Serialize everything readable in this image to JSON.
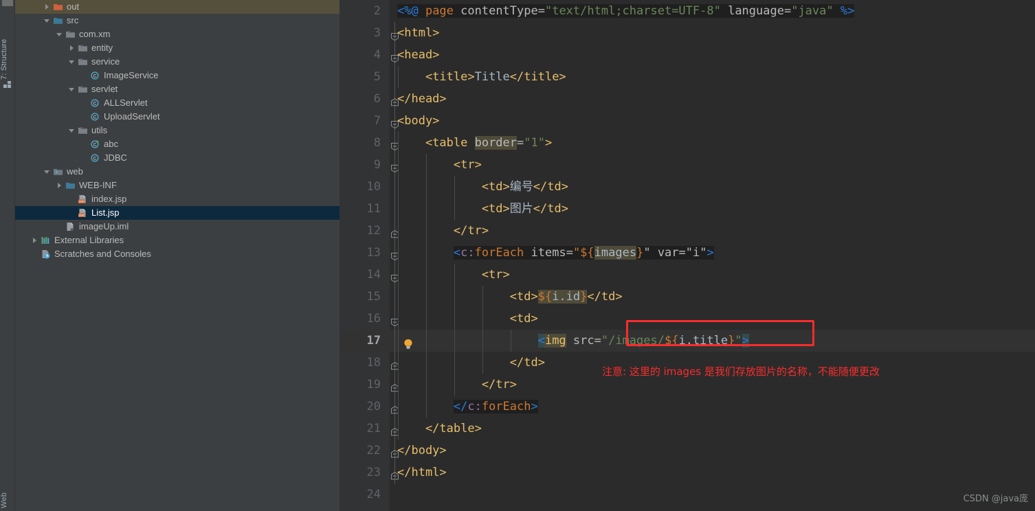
{
  "toolstrip": {
    "structure_tab": "7: Structure",
    "web_tab": "Web"
  },
  "tree": {
    "items": [
      {
        "label": "out",
        "indent": 1,
        "twisty": "right",
        "icon": "folder-orange",
        "state": "hovered"
      },
      {
        "label": "src",
        "indent": 1,
        "twisty": "down",
        "icon": "folder-source",
        "state": "normal"
      },
      {
        "label": "com.xm",
        "indent": 2,
        "twisty": "down",
        "icon": "package",
        "state": "normal"
      },
      {
        "label": "entity",
        "indent": 3,
        "twisty": "right",
        "icon": "package",
        "state": "normal"
      },
      {
        "label": "service",
        "indent": 3,
        "twisty": "down",
        "icon": "package",
        "state": "normal"
      },
      {
        "label": "ImageService",
        "indent": 4,
        "twisty": "none",
        "icon": "java-class",
        "state": "normal"
      },
      {
        "label": "servlet",
        "indent": 3,
        "twisty": "down",
        "icon": "package",
        "state": "normal"
      },
      {
        "label": "ALLServlet",
        "indent": 4,
        "twisty": "none",
        "icon": "java-class",
        "state": "normal"
      },
      {
        "label": "UploadServlet",
        "indent": 4,
        "twisty": "none",
        "icon": "java-class",
        "state": "normal"
      },
      {
        "label": "utils",
        "indent": 3,
        "twisty": "down",
        "icon": "package",
        "state": "normal"
      },
      {
        "label": "abc",
        "indent": 4,
        "twisty": "none",
        "icon": "java-class-run",
        "state": "normal"
      },
      {
        "label": "JDBC",
        "indent": 4,
        "twisty": "none",
        "icon": "java-class",
        "state": "normal"
      },
      {
        "label": "web",
        "indent": 1,
        "twisty": "down",
        "icon": "folder-web",
        "state": "normal"
      },
      {
        "label": "WEB-INF",
        "indent": 2,
        "twisty": "right",
        "icon": "folder-blue",
        "state": "normal"
      },
      {
        "label": "index.jsp",
        "indent": 3,
        "twisty": "none",
        "icon": "jsp-file",
        "state": "normal"
      },
      {
        "label": "List.jsp",
        "indent": 3,
        "twisty": "none",
        "icon": "jsp-file",
        "state": "selected"
      },
      {
        "label": "imageUp.iml",
        "indent": 2,
        "twisty": "none",
        "icon": "iml-file",
        "state": "normal"
      },
      {
        "label": "External Libraries",
        "indent": 0,
        "twisty": "right",
        "icon": "libraries",
        "state": "normal"
      },
      {
        "label": "Scratches and Consoles",
        "indent": 0,
        "twisty": "none",
        "icon": "scratches",
        "state": "normal"
      }
    ]
  },
  "editor": {
    "first_visible_line": 2,
    "current_line": 17,
    "lines": [
      {
        "num": 2,
        "fold": "none",
        "guides": 0,
        "bulb": false,
        "current": false,
        "tokens": [
          {
            "t": "<%@ ",
            "c": "t-jspbr",
            "hl": "dir"
          },
          {
            "t": "page",
            "c": "t-kw",
            "hl": "dir"
          },
          {
            "t": " contentType=",
            "c": "t-attr",
            "hl": "dir"
          },
          {
            "t": "\"text/html;charset=UTF-8\"",
            "c": "t-str",
            "hl": "dir"
          },
          {
            "t": " language=",
            "c": "t-attr",
            "hl": "dir"
          },
          {
            "t": "\"java\"",
            "c": "t-str",
            "hl": "dir"
          },
          {
            "t": " %>",
            "c": "t-jspbr",
            "hl": "dir"
          }
        ]
      },
      {
        "num": 3,
        "fold": "open",
        "guides": 0,
        "bulb": false,
        "current": false,
        "tokens": [
          {
            "t": "<html>",
            "c": "t-tag"
          }
        ]
      },
      {
        "num": 4,
        "fold": "open",
        "guides": 0,
        "bulb": false,
        "current": false,
        "tokens": [
          {
            "t": "<head>",
            "c": "t-tag"
          }
        ]
      },
      {
        "num": 5,
        "fold": "none",
        "guides": 1,
        "bulb": false,
        "current": false,
        "tokens": [
          {
            "t": "    <title>",
            "c": "t-tag"
          },
          {
            "t": "Title",
            "c": "t-txt"
          },
          {
            "t": "</title>",
            "c": "t-tag"
          }
        ]
      },
      {
        "num": 6,
        "fold": "close",
        "guides": 0,
        "bulb": false,
        "current": false,
        "tokens": [
          {
            "t": "</head>",
            "c": "t-tag"
          }
        ]
      },
      {
        "num": 7,
        "fold": "open",
        "guides": 0,
        "bulb": false,
        "current": false,
        "tokens": [
          {
            "t": "<body>",
            "c": "t-tag"
          }
        ]
      },
      {
        "num": 8,
        "fold": "open",
        "guides": 1,
        "bulb": false,
        "current": false,
        "tokens": [
          {
            "t": "    <table ",
            "c": "t-tag"
          },
          {
            "t": "border",
            "c": "t-attr",
            "hl": "ident"
          },
          {
            "t": "=",
            "c": "t-attr"
          },
          {
            "t": "\"1\"",
            "c": "t-str"
          },
          {
            "t": ">",
            "c": "t-tag"
          }
        ]
      },
      {
        "num": 9,
        "fold": "open",
        "guides": 2,
        "bulb": false,
        "current": false,
        "tokens": [
          {
            "t": "        <tr>",
            "c": "t-tag"
          }
        ]
      },
      {
        "num": 10,
        "fold": "none",
        "guides": 3,
        "bulb": false,
        "current": false,
        "tokens": [
          {
            "t": "            <td>",
            "c": "t-tag"
          },
          {
            "t": "编号",
            "c": "t-txt"
          },
          {
            "t": "</td>",
            "c": "t-tag"
          }
        ]
      },
      {
        "num": 11,
        "fold": "none",
        "guides": 3,
        "bulb": false,
        "current": false,
        "tokens": [
          {
            "t": "            <td>",
            "c": "t-tag"
          },
          {
            "t": "图片",
            "c": "t-txt"
          },
          {
            "t": "</td>",
            "c": "t-tag"
          }
        ]
      },
      {
        "num": 12,
        "fold": "close",
        "guides": 2,
        "bulb": false,
        "current": false,
        "tokens": [
          {
            "t": "        </tr>",
            "c": "t-tag"
          }
        ]
      },
      {
        "num": 13,
        "fold": "open",
        "guides": 2,
        "bulb": false,
        "current": false,
        "tokens": [
          {
            "t": "        ",
            "c": "t-tag"
          },
          {
            "t": "<",
            "c": "t-jspbr",
            "hl": "dir"
          },
          {
            "t": "c:",
            "c": "t-ns",
            "hl": "dir"
          },
          {
            "t": "forEach",
            "c": "t-el",
            "hl": "dir"
          },
          {
            "t": " items=",
            "c": "t-attr",
            "hl": "dir"
          },
          {
            "t": "\"${",
            "c": "t-el",
            "hl": "dir"
          },
          {
            "t": "images",
            "c": "t-elin",
            "hl": "ident"
          },
          {
            "t": "}",
            "c": "t-el",
            "hl": "dir"
          },
          {
            "t": "\"",
            "c": "t-attr",
            "hl": "dir"
          },
          {
            "t": " var=",
            "c": "t-attr",
            "hl": "dir"
          },
          {
            "t": "\"i\"",
            "c": "t-attr",
            "hl": "dir"
          },
          {
            "t": ">",
            "c": "t-jspbr",
            "hl": "dir"
          }
        ]
      },
      {
        "num": 14,
        "fold": "open",
        "guides": 3,
        "bulb": false,
        "current": false,
        "tokens": [
          {
            "t": "            <tr>",
            "c": "t-tag"
          }
        ]
      },
      {
        "num": 15,
        "fold": "none",
        "guides": 4,
        "bulb": false,
        "current": false,
        "tokens": [
          {
            "t": "                <td>",
            "c": "t-tag"
          },
          {
            "t": "${",
            "c": "t-el",
            "hl": "ident"
          },
          {
            "t": "i.id",
            "c": "t-elin",
            "hl": "ident"
          },
          {
            "t": "}",
            "c": "t-el",
            "hl": "ident"
          },
          {
            "t": "</td>",
            "c": "t-tag"
          }
        ]
      },
      {
        "num": 16,
        "fold": "open",
        "guides": 4,
        "bulb": false,
        "current": false,
        "tokens": [
          {
            "t": "                <td>",
            "c": "t-tag"
          }
        ]
      },
      {
        "num": 17,
        "fold": "none",
        "guides": 5,
        "bulb": true,
        "current": true,
        "tokens": [
          {
            "t": "                    ",
            "c": "t-tag"
          },
          {
            "t": "<",
            "c": "t-jspbr",
            "hl": "teal"
          },
          {
            "t": "img",
            "c": "t-tag",
            "hl": "ident"
          },
          {
            "t": " src=",
            "c": "t-attr"
          },
          {
            "t": "\"/images/",
            "c": "t-str"
          },
          {
            "t": "${",
            "c": "t-el"
          },
          {
            "t": "i.title",
            "c": "t-elin"
          },
          {
            "t": "}",
            "c": "t-el"
          },
          {
            "t": "\"",
            "c": "t-str"
          },
          {
            "t": ">",
            "c": "t-jspbr",
            "hl": "teal"
          }
        ]
      },
      {
        "num": 18,
        "fold": "close",
        "guides": 4,
        "bulb": false,
        "current": false,
        "tokens": [
          {
            "t": "                </td>",
            "c": "t-tag"
          }
        ]
      },
      {
        "num": 19,
        "fold": "close",
        "guides": 3,
        "bulb": false,
        "current": false,
        "tokens": [
          {
            "t": "            </tr>",
            "c": "t-tag"
          }
        ]
      },
      {
        "num": 20,
        "fold": "close",
        "guides": 2,
        "bulb": false,
        "current": false,
        "tokens": [
          {
            "t": "        ",
            "c": "t-tag"
          },
          {
            "t": "</",
            "c": "t-jspbr",
            "hl": "dir"
          },
          {
            "t": "c:",
            "c": "t-ns",
            "hl": "dir"
          },
          {
            "t": "forEach",
            "c": "t-el",
            "hl": "dir"
          },
          {
            "t": ">",
            "c": "t-jspbr",
            "hl": "dir"
          }
        ]
      },
      {
        "num": 21,
        "fold": "close",
        "guides": 1,
        "bulb": false,
        "current": false,
        "tokens": [
          {
            "t": "    </table>",
            "c": "t-tag"
          }
        ]
      },
      {
        "num": 22,
        "fold": "close",
        "guides": 0,
        "bulb": false,
        "current": false,
        "tokens": [
          {
            "t": "</body>",
            "c": "t-tag"
          }
        ]
      },
      {
        "num": 23,
        "fold": "close",
        "guides": 0,
        "bulb": false,
        "current": false,
        "tokens": [
          {
            "t": "</html>",
            "c": "t-tag"
          }
        ]
      },
      {
        "num": 24,
        "fold": "none",
        "guides": 0,
        "bulb": false,
        "current": false,
        "tokens": []
      }
    ]
  },
  "annotation": {
    "note_text": "注意: 这里的 images 是我们存放图片的名称，不能随便更改",
    "highlight_color": "#fb2c2c"
  },
  "watermark": {
    "text": "CSDN @java庞"
  },
  "colors": {
    "panel_bg": "#3c3f41",
    "editor_bg": "#2b2b2b",
    "gutter_bg": "#313335",
    "current_line_bg": "#323232",
    "selection_bg": "#0d293e",
    "hover_bg": "#55503c",
    "tag_color": "#e8bf6a",
    "string_color": "#6a8759",
    "keyword_color": "#cc7832",
    "attr_color": "#bababa",
    "text_color": "#a9b7c6",
    "ns_color": "#9876aa",
    "jsp_bracket_color": "#287bde",
    "ident_highlight": "#4e4b39",
    "directive_bg": "#1f1f1f"
  }
}
